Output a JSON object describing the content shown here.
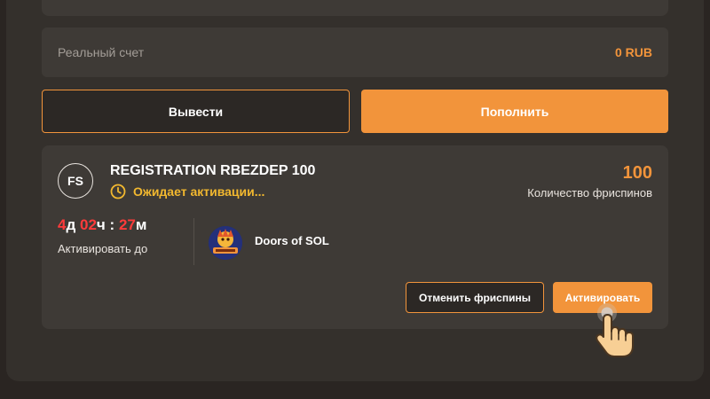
{
  "account": {
    "real_label": "Реальный счет",
    "real_value": "0 RUB"
  },
  "actions": {
    "withdraw_label": "Вывести",
    "deposit_label": "Пополнить"
  },
  "promo": {
    "badge": "FS",
    "title": "REGISTRATION RBEZDEP 100",
    "status": "Ожидает активации...",
    "spins_count": "100",
    "spins_label": "Количество фриспинов",
    "timer": {
      "days": "4",
      "days_unit": "д",
      "hours": "02",
      "hours_unit": "ч",
      "separator": ":",
      "minutes": "27",
      "minutes_unit": "м"
    },
    "activate_until_label": "Активировать до",
    "game_name": "Doors of SOL",
    "cancel_label": "Отменить фриспины",
    "activate_label": "Активировать"
  },
  "colors": {
    "accent": "#f2943b",
    "status": "#f2b82f",
    "timer_number": "#ff3b3b",
    "card": "#3e3a36",
    "panel": "#34302c"
  },
  "icons": {
    "status": "clock-icon",
    "cursor": "hand-pointer-icon"
  }
}
